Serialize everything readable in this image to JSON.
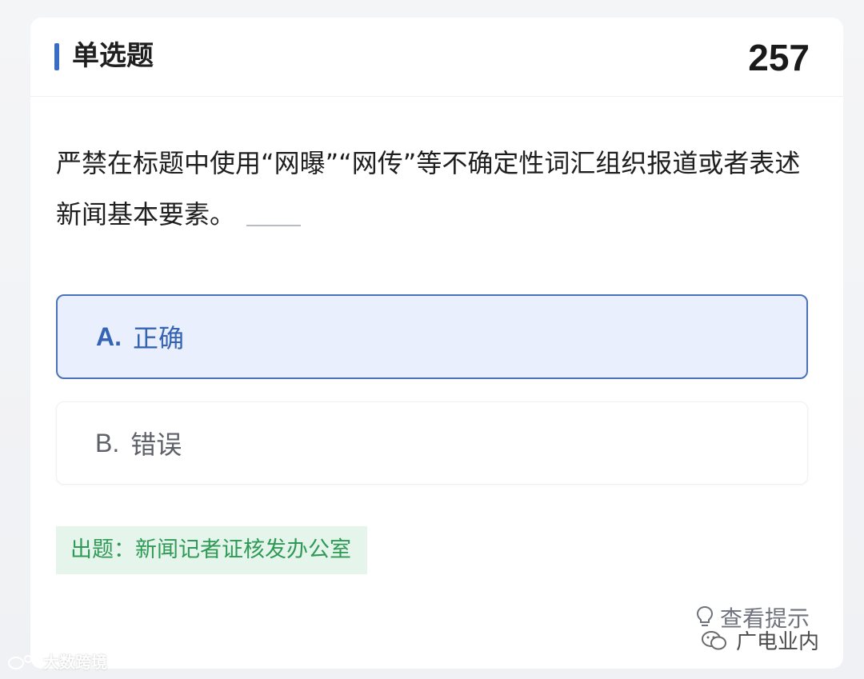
{
  "header": {
    "title": "单选题",
    "number": "257",
    "accent_color": "#3b6cc4"
  },
  "question": {
    "text": "严禁在标题中使用“网曝”“网传”等不确定性词汇组织报道或者表述新闻基本要素。"
  },
  "options": [
    {
      "letter": "A.",
      "label": "正确",
      "selected": true
    },
    {
      "letter": "B.",
      "label": "错误",
      "selected": false
    }
  ],
  "source": {
    "text": "出题：新闻记者证核发办公室"
  },
  "hint": {
    "label": "查看提示",
    "icon": "lightbulb-icon"
  },
  "watermarks": {
    "right_text": "广电业内",
    "right_icon": "wechat-icon",
    "left_text": "大数跨境",
    "left_icon": "weibo-icon"
  },
  "colors": {
    "selected_bg": "#e9effc",
    "selected_border": "#4a72b8",
    "source_bg": "#e6f5ec",
    "source_text": "#2f9a55"
  }
}
